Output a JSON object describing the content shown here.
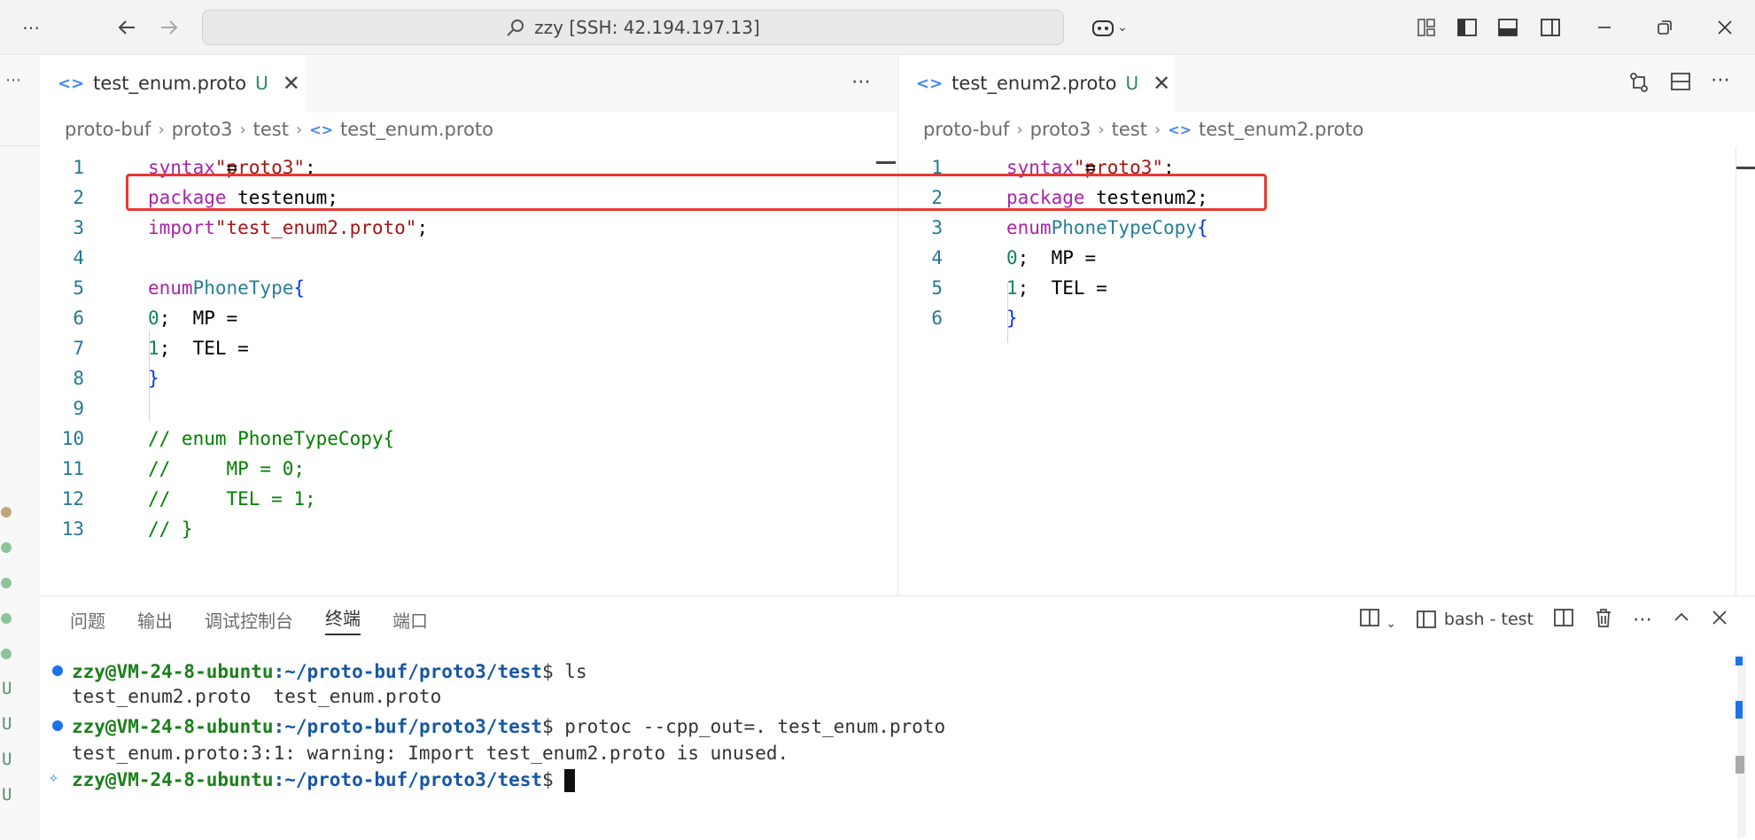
{
  "titlebar": {
    "search_text": "zzy [SSH: 42.194.197.13]",
    "more_icon": "ellipsis-icon",
    "back_icon": "arrow-left-icon",
    "forward_icon": "arrow-right-icon",
    "copilot_icon": "copilot-icon"
  },
  "left_group": {
    "tab_label": "test_enum.proto",
    "tab_status": "U",
    "breadcrumb": [
      "proto-buf",
      "proto3",
      "test",
      "test_enum.proto"
    ],
    "lines": [
      {
        "n": "1",
        "segments": [
          [
            "kw",
            "syntax"
          ],
          [
            "txt",
            " = "
          ],
          [
            "str",
            "\"proto3\""
          ],
          [
            "txt",
            ";"
          ]
        ]
      },
      {
        "n": "2",
        "segments": [
          [
            "kw",
            "package"
          ],
          [
            "txt",
            " testenum;"
          ]
        ]
      },
      {
        "n": "3",
        "segments": [
          [
            "kw",
            "import"
          ],
          [
            "txt",
            " "
          ],
          [
            "str",
            "\"test_enum2.proto\""
          ],
          [
            "txt",
            ";"
          ]
        ]
      },
      {
        "n": "4",
        "segments": []
      },
      {
        "n": "5",
        "segments": [
          [
            "kw",
            "enum"
          ],
          [
            "txt",
            " "
          ],
          [
            "type",
            "PhoneType"
          ],
          [
            "brace",
            "{"
          ]
        ]
      },
      {
        "n": "6",
        "segments": [
          [
            "txt",
            "    MP = "
          ],
          [
            "num",
            "0"
          ],
          [
            "txt",
            ";"
          ]
        ]
      },
      {
        "n": "7",
        "segments": [
          [
            "txt",
            "    TEL = "
          ],
          [
            "num",
            "1"
          ],
          [
            "txt",
            ";"
          ]
        ]
      },
      {
        "n": "8",
        "segments": [
          [
            "brace",
            "}"
          ]
        ]
      },
      {
        "n": "9",
        "segments": []
      },
      {
        "n": "10",
        "segments": [
          [
            "cmt",
            "// enum PhoneTypeCopy{"
          ]
        ]
      },
      {
        "n": "11",
        "segments": [
          [
            "cmt",
            "//     MP = 0;"
          ]
        ]
      },
      {
        "n": "12",
        "segments": [
          [
            "cmt",
            "//     TEL = 1;"
          ]
        ]
      },
      {
        "n": "13",
        "segments": [
          [
            "cmt",
            "// }"
          ]
        ]
      }
    ]
  },
  "right_group": {
    "tab_label": "test_enum2.proto",
    "tab_status": "U",
    "breadcrumb": [
      "proto-buf",
      "proto3",
      "test",
      "test_enum2.proto"
    ],
    "lines": [
      {
        "n": "1",
        "segments": [
          [
            "kw",
            "syntax"
          ],
          [
            "txt",
            " = "
          ],
          [
            "str",
            "\"proto3\""
          ],
          [
            "txt",
            ";"
          ]
        ]
      },
      {
        "n": "2",
        "segments": [
          [
            "kw",
            "package"
          ],
          [
            "txt",
            " testenum2;"
          ]
        ]
      },
      {
        "n": "3",
        "segments": [
          [
            "kw",
            "enum"
          ],
          [
            "txt",
            " "
          ],
          [
            "type",
            "PhoneTypeCopy"
          ],
          [
            "brace",
            "{"
          ]
        ]
      },
      {
        "n": "4",
        "segments": [
          [
            "txt",
            "    MP = "
          ],
          [
            "num",
            "0"
          ],
          [
            "txt",
            ";"
          ]
        ]
      },
      {
        "n": "5",
        "segments": [
          [
            "txt",
            "    TEL = "
          ],
          [
            "num",
            "1"
          ],
          [
            "txt",
            ";"
          ]
        ]
      },
      {
        "n": "6",
        "segments": [
          [
            "brace",
            "}"
          ]
        ]
      }
    ]
  },
  "panel": {
    "tabs": [
      "问题",
      "输出",
      "调试控制台",
      "终端",
      "端口"
    ],
    "active_tab": "终端",
    "terminal_name": "bash - test"
  },
  "terminal": {
    "user": "zzy@VM-24-8-ubuntu",
    "path": ":~/proto-buf/proto3/test",
    "cmd1": "$ ls",
    "out1": "test_enum2.proto  test_enum.proto",
    "cmd2": "$ protoc --cpp_out=. test_enum.proto",
    "out2": "test_enum.proto:3:1: warning: Import test_enum2.proto is unused.",
    "cmd3": "$ "
  },
  "left_strip": {
    "markers": [
      "U",
      "U",
      "U",
      "U"
    ]
  },
  "colors": {
    "highlight": "#e53935",
    "keyword": "#a626a4",
    "string": "#a31515",
    "number": "#098658",
    "comment": "#008000",
    "type": "#267f99"
  }
}
